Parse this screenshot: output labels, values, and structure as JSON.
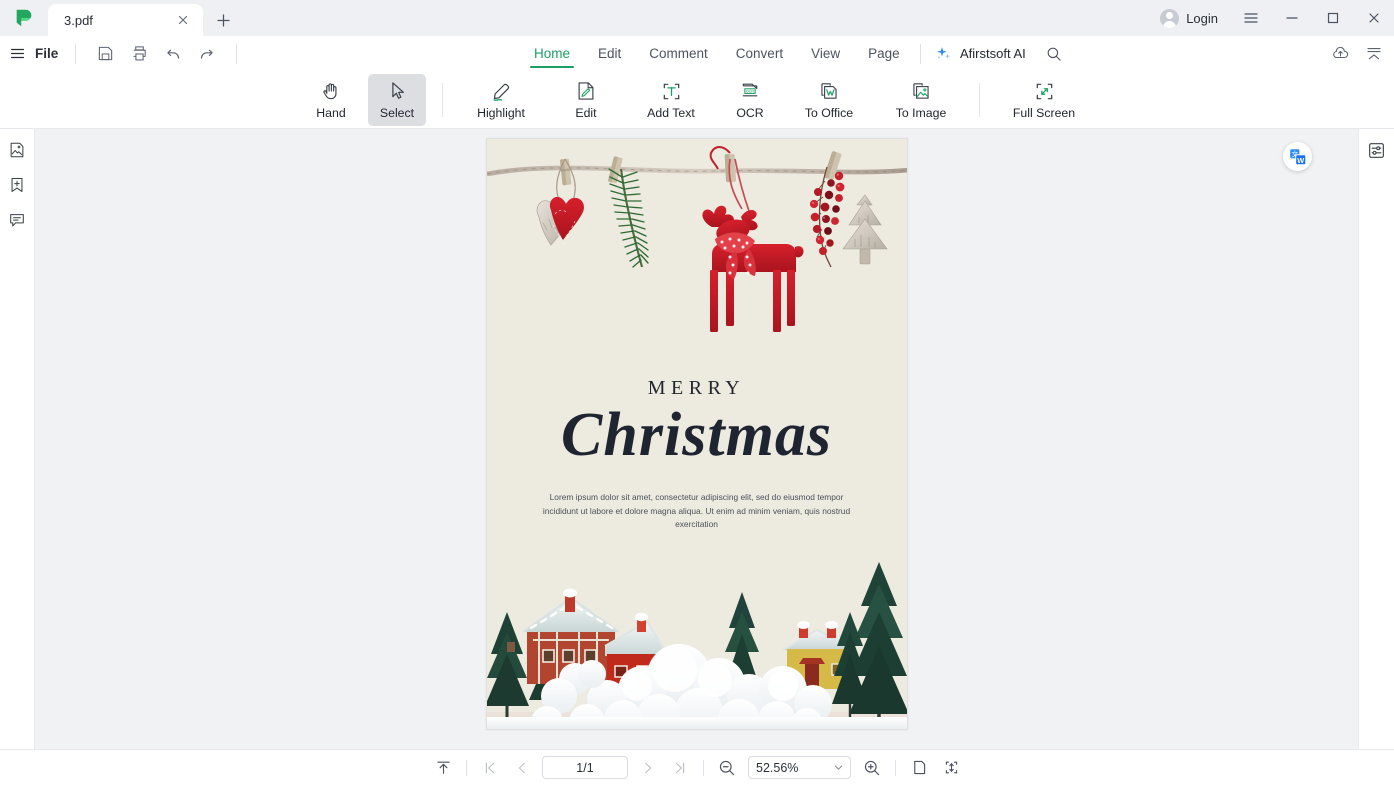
{
  "window": {
    "logo_icon": "afirstsoft-logo-icon",
    "tabs": [
      {
        "title": "3.pdf",
        "close_icon": "close-icon"
      }
    ],
    "new_tab_icon": "plus-icon",
    "login_label": "Login",
    "avatar_icon": "user-avatar-icon",
    "menu_icon": "hamburger-menu-icon",
    "minimize_icon": "minimize-icon",
    "maximize_icon": "maximize-icon",
    "close_icon": "close-icon"
  },
  "menubar": {
    "app_menu_icon": "hamburger-menu-icon",
    "file_label": "File",
    "quick_access": [
      {
        "name": "save-button",
        "icon": "save-icon"
      },
      {
        "name": "print-button",
        "icon": "print-icon"
      },
      {
        "name": "undo-button",
        "icon": "undo-icon"
      },
      {
        "name": "redo-button",
        "icon": "redo-icon"
      }
    ],
    "tabs": [
      {
        "label": "Home",
        "active": true
      },
      {
        "label": "Edit",
        "active": false
      },
      {
        "label": "Comment",
        "active": false
      },
      {
        "label": "Convert",
        "active": false
      },
      {
        "label": "View",
        "active": false
      },
      {
        "label": "Page",
        "active": false
      }
    ],
    "ai_label": "Afirstsoft AI",
    "ai_icon": "sparkle-icon",
    "search_icon": "search-icon",
    "cloud_icon": "cloud-upload-icon",
    "collapse_icon": "collapse-ribbon-icon"
  },
  "ribbon": {
    "tools": [
      {
        "label": "Hand",
        "icon": "hand-icon",
        "selected": false
      },
      {
        "label": "Select",
        "icon": "cursor-arrow-icon",
        "selected": true
      },
      {
        "label": "Highlight",
        "icon": "highlighter-pen-icon",
        "selected": false
      },
      {
        "label": "Edit",
        "icon": "edit-document-icon",
        "selected": false
      },
      {
        "label": "Add Text",
        "icon": "add-text-icon",
        "selected": false
      },
      {
        "label": "OCR",
        "icon": "ocr-icon",
        "selected": false
      },
      {
        "label": "To Office",
        "icon": "to-word-icon",
        "selected": false
      },
      {
        "label": "To Image",
        "icon": "to-image-icon",
        "selected": false
      },
      {
        "label": "Full Screen",
        "icon": "full-screen-icon",
        "selected": false
      }
    ]
  },
  "left_sidebar": {
    "items": [
      {
        "name": "thumbnails-panel-button",
        "icon": "thumbnail-image-icon"
      },
      {
        "name": "bookmarks-panel-button",
        "icon": "bookmark-plus-icon"
      },
      {
        "name": "comments-panel-button",
        "icon": "comment-bubble-icon"
      }
    ]
  },
  "right_sidebar": {
    "items": [
      {
        "name": "properties-panel-button",
        "icon": "sliders-settings-icon"
      }
    ],
    "translate_fab_icon": "translate-to-word-icon"
  },
  "document": {
    "heading_small": "MERRY",
    "heading_large": "Christmas",
    "body_text": "Lorem ipsum dolor sit amet, consectetur adipiscing elit, sed do eiusmod tempor incididunt ut labore et dolore magna aliqua. Ut enim ad minim veniam, quis nostrud exercitation",
    "background_color": "#edeae0",
    "top_image_alt": "christmas-ornaments-on-twine-photo",
    "bottom_image_alt": "snowy-village-miniature-photo"
  },
  "statusbar": {
    "fit_top_icon": "scroll-to-top-icon",
    "first_page_icon": "first-page-icon",
    "prev_page_icon": "previous-page-icon",
    "page_value": "1/1",
    "next_page_icon": "next-page-icon",
    "last_page_icon": "last-page-icon",
    "zoom_out_icon": "zoom-out-icon",
    "zoom_value": "52.56%",
    "zoom_caret_icon": "chevron-down-icon",
    "zoom_in_icon": "zoom-in-icon",
    "single_page_icon": "single-page-view-icon",
    "fit_page_icon": "fit-page-icon"
  },
  "colors": {
    "accent_green": "#1aa063",
    "ai_blue": "#2f8cf5",
    "titlebar_bg": "#eef0f3",
    "viewer_bg": "#f1f2f4"
  }
}
